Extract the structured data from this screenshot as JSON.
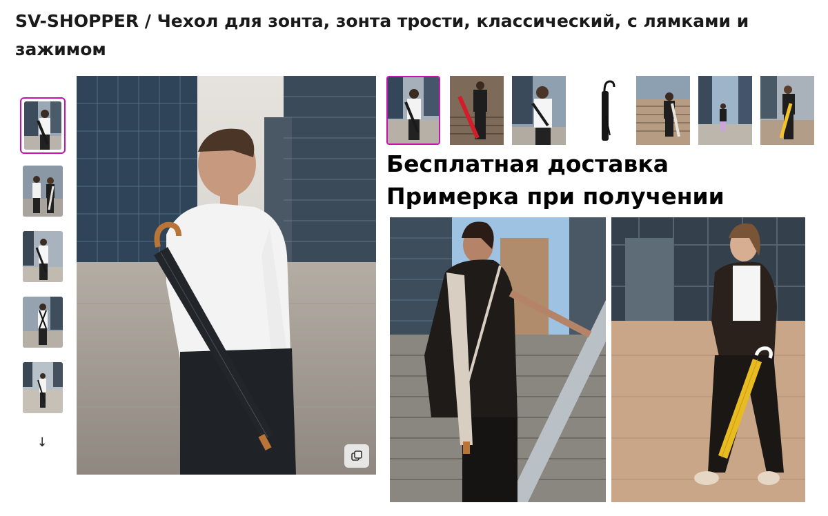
{
  "product": {
    "title": "SV-SHOPPER / Чехол для зонта, зонта трости, классический, с лямками и зажимом"
  },
  "gallery": {
    "thumbnails_vertical": [
      {
        "alt": "man-white-shirt-umbrella-back"
      },
      {
        "alt": "couple-with-umbrellas"
      },
      {
        "alt": "man-side-umbrella"
      },
      {
        "alt": "man-front-strap"
      },
      {
        "alt": "man-full-length"
      }
    ],
    "scroll_down_glyph": "↓",
    "copy_icon": "copy-icon",
    "thumbnails_horizontal_count": 7
  },
  "promo": {
    "line1": "Бесплатная доставка",
    "line2": "Примерка при получении"
  },
  "colors": {
    "active_border": "#cb11ab",
    "title_text": "#1a1a1a"
  }
}
